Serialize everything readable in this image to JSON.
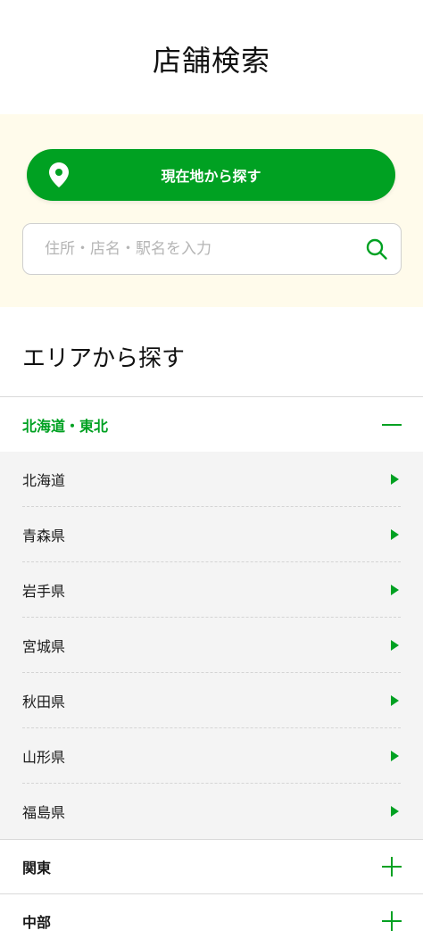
{
  "page": {
    "title": "店舗検索"
  },
  "search": {
    "location_button_label": "現在地から探す",
    "placeholder": "住所・店名・駅名を入力",
    "value": ""
  },
  "area": {
    "section_title": "エリアから探す",
    "regions": [
      {
        "label": "北海道・東北",
        "expanded": true,
        "prefectures": [
          "北海道",
          "青森県",
          "岩手県",
          "宮城県",
          "秋田県",
          "山形県",
          "福島県"
        ]
      },
      {
        "label": "関東",
        "expanded": false
      },
      {
        "label": "中部",
        "expanded": false
      }
    ]
  },
  "colors": {
    "accent": "#00a122",
    "panel_bg": "#fffbeb",
    "list_bg": "#f4f4f4"
  },
  "icons": {
    "location": "map-pin-icon",
    "search": "search-icon",
    "collapse": "minus-icon",
    "expand": "plus-icon",
    "item": "triangle-right-icon"
  }
}
